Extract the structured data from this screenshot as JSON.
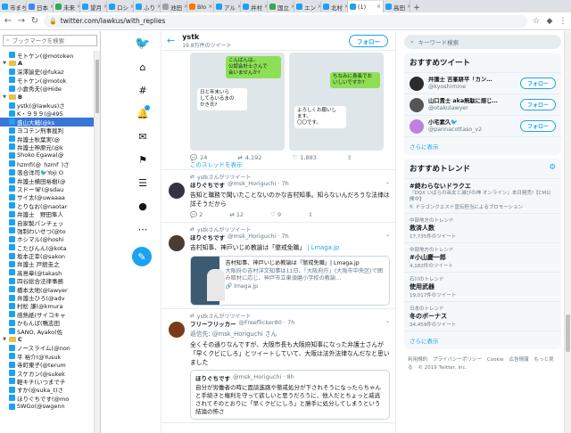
{
  "browser": {
    "tabs": [
      {
        "label": "市まち",
        "color": "#1da1f2"
      },
      {
        "label": "日本",
        "color": "#4285f4"
      },
      {
        "label": "未来",
        "color": "#34a853"
      },
      {
        "label": "望月",
        "color": "#1da1f2"
      },
      {
        "label": "ロシ",
        "color": "#1da1f2"
      },
      {
        "label": "ふり",
        "color": "#1da1f2"
      },
      {
        "label": "池田",
        "color": "#9e9e9e"
      },
      {
        "label": "Blo",
        "color": "#f57c00"
      },
      {
        "label": "アル",
        "color": "#1da1f2"
      },
      {
        "label": "井村",
        "color": "#1da1f2"
      },
      {
        "label": "国立",
        "color": "#34a853"
      },
      {
        "label": "エン",
        "color": "#1da1f2"
      },
      {
        "label": "北村",
        "color": "#1da1f2"
      },
      {
        "label": "(1)",
        "color": "#1da1f2",
        "active": true
      },
      {
        "label": "高田",
        "color": "#1da1f2"
      }
    ],
    "url": "twitter.com/lawkus/with_replies",
    "tab_close": "×",
    "tab_new": "+"
  },
  "bookmarks": {
    "search_placeholder": "ブックマークを検索",
    "rows": [
      {
        "label": "モトケン(@motoken_",
        "type": "item"
      },
      {
        "label": "A",
        "type": "folder"
      },
      {
        "label": "深澤諭史(@fukaz",
        "type": "item"
      },
      {
        "label": "モトケン(@motok",
        "type": "item"
      },
      {
        "label": "小倉秀夫(@Hide",
        "type": "item"
      },
      {
        "label": "B",
        "type": "folder"
      },
      {
        "label": "ystk(@lawkus)さ",
        "type": "item"
      },
      {
        "label": "K・９９９(@495",
        "type": "item"
      },
      {
        "label": "盛山大輔(@ks",
        "type": "item",
        "selected": true
      },
      {
        "label": "ヨコテン刑事裁判",
        "type": "item"
      },
      {
        "label": "弁護士秋葉実(@",
        "type": "item"
      },
      {
        "label": "弁護士神原元(@k",
        "type": "item"
      },
      {
        "label": "Shoko Egawa(@",
        "type": "item"
      },
      {
        "label": "hzmfi(@_hzmf_)さ",
        "type": "item"
      },
      {
        "label": "落合洋司🐦Yoji O",
        "type": "item"
      },
      {
        "label": "弁護士横田裕樹(@",
        "type": "item"
      },
      {
        "label": "スドー🐨(@sdau",
        "type": "item"
      },
      {
        "label": "サイ太(@uwaaaa",
        "type": "item"
      },
      {
        "label": "とりなお(@naotar",
        "type": "item"
      },
      {
        "label": "弁護士　野田隼人",
        "type": "item"
      },
      {
        "label": "自家製パンチェッ",
        "type": "item"
      },
      {
        "label": "強制わいせつ(@to",
        "type": "item"
      },
      {
        "label": "ホシマル(@hoshi",
        "type": "item"
      },
      {
        "label": "こたびんん(@kota",
        "type": "item"
      },
      {
        "label": "坂本正幸(@sakon",
        "type": "item"
      },
      {
        "label": "弁護士 戸舘圭之",
        "type": "item"
      },
      {
        "label": "高島章(@takash",
        "type": "item"
      },
      {
        "label": "四谷総合法律事務",
        "type": "item"
      },
      {
        "label": "橋本太地(@lawyer",
        "type": "item"
      },
      {
        "label": "弁護士ひろ(@adv",
        "type": "item"
      },
      {
        "label": "村松 謙(@kmura",
        "type": "item"
      },
      {
        "label": "感熱紙(サイコキャ",
        "type": "item"
      },
      {
        "label": "かもんば(鴨志田",
        "type": "item"
      },
      {
        "label": "SANO, Ayako(佐",
        "type": "item"
      },
      {
        "label": "C",
        "type": "folder"
      },
      {
        "label": "ノースライム(@non",
        "type": "item"
      },
      {
        "label": "平 裕介(@Yusuk",
        "type": "item"
      },
      {
        "label": "寺町東子(@terum",
        "type": "item"
      },
      {
        "label": "スケカン(@sukek",
        "type": "item"
      },
      {
        "label": "軽キチ(いつまでチ",
        "type": "item"
      },
      {
        "label": "すか(@suka_t)さ",
        "type": "item"
      },
      {
        "label": "ほりぐちです(@mo",
        "type": "item"
      },
      {
        "label": "SWGo(@swgenn",
        "type": "item"
      }
    ]
  },
  "twitter": {
    "header": {
      "name": "ystk",
      "count": "19.8万件のツイート",
      "follow_label": "フォロー"
    },
    "first_tweet": {
      "img1_bubbles": [
        "こんばんは。\n公認会計士さんで\n会いませんか?",
        "日と年末いら\nしてるいるまの\nかき氏?"
      ],
      "img2_bubbles": [
        "ちなみに身長でお\nいしいですか?",
        "よろしくお願いし\nます。\n〇〇です。"
      ],
      "replies": "24",
      "retweets": "4,192",
      "likes": "1,883",
      "thread_link": "このスレッドを表示"
    },
    "tweets": [
      {
        "rt": "ystkさんがリツイート",
        "name": "ほりぐちです",
        "handle": "@msk_Horiguchi · 7h",
        "body": "告知と職務で聞いたことないのかな吉村知事。知らないんだろうな法律は詳そうだから",
        "replies": "2",
        "retweets": "12",
        "likes": "9"
      },
      {
        "rt": "ystkさんがリツイート",
        "name": "ほりぐちです",
        "handle": "@msk_Horiguchi · 7h",
        "body": "吉村知事、神戸いじめ教諭は「懲戒免職」",
        "link": "| Lmaga.jp",
        "card_title": "吉村知事、神戸いじめ教諭は「懲戒免職」| Lmaga.jp",
        "card_desc": "大阪府の吉村洋文知事は11日、「大阪府庁」(大阪市中央区)で囲み取材に応じ、神戸市立東須磨小学校の教諭…",
        "card_domain": "lmaga.jp"
      },
      {
        "rt": "ystkさんがリツイート",
        "name": "フリーフリッカー",
        "handle": "@Freeflicker80 · 7h",
        "reply_to": "返信先: @msk_Horiguchi さん",
        "body": "全くその通りなんですが、大阪市長も大阪府知事になった弁護士さんが「早くクビにしろ」とツイートしていて、大阪は法外法律なんだなと思いました",
        "quote_name": "ほりぐちです",
        "quote_handle": "@msk_Horiguchi · 8h",
        "quote_body": "自分が労働者の時に面談進路や懲戒処分が下されそうになったらちゃんと手続きと権利を守って欲しいと思うだろうに、他人だとちょっと威逃されてそのとおりに「早くクビにしろ」と勝手に処分してしまうという結論の怖さ"
      }
    ]
  },
  "right": {
    "search_placeholder": "キーワード検索",
    "who_title": "おすすめツイート",
    "who": [
      {
        "name": "弁護士 吉峯耕平「カン…",
        "handle": "@kyoshimine",
        "color": "#2b2b2b",
        "btn": "フォロー"
      },
      {
        "name": "山口貴士 aka無駄に感じ…",
        "handle": "@otakulawyer",
        "color": "#555555",
        "btn": "フォロー"
      },
      {
        "name": "小宅素久🐦",
        "handle": "@pannacottaso_v2",
        "color": "#c080e0",
        "btn": "フォロー"
      }
    ],
    "more1": "さらに表示",
    "trends_title": "おすすめトレンド",
    "trends": [
      {
        "cat": "",
        "name": "#終わらないドラクエ",
        "extra": "『DQX いばらの巫女と滅びの神 オンライン』本日発売!【CM公開中】",
        "promo": "ドラゴンクエスト宣伝担当によるプロモーション"
      },
      {
        "cat": "中部地方のトレンド",
        "name": "救済人数",
        "count": "17,735件のツイート"
      },
      {
        "cat": "中部地方のトレンド",
        "name": "#小山慶一郎",
        "count": "4,182件のツイート"
      },
      {
        "cat": "石川のトレンド",
        "name": "使用武器",
        "count": "19,017件のツイート"
      },
      {
        "cat": "日本のトレンド",
        "name": "冬のボーナス",
        "count": "34,459件のツイート"
      }
    ],
    "more2": "さらに表示",
    "footer": [
      "利用規約",
      "プライバシーポリシー",
      "Cookie",
      "広告情報",
      "もっと見る",
      "© 2019 Twitter, Inc."
    ]
  }
}
